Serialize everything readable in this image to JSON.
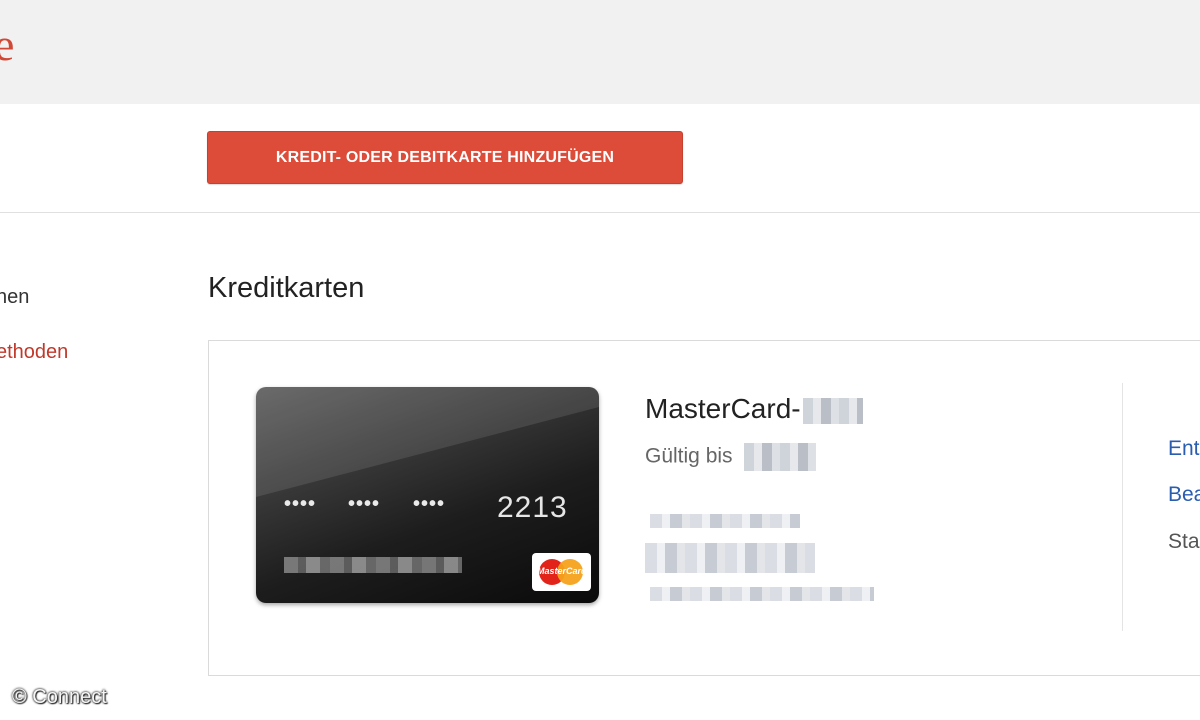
{
  "header": {
    "logo_fragment": "e"
  },
  "toolbar": {
    "add_card_label": "KREDIT- ODER DEBITKARTE HINZUFÜGEN"
  },
  "sidebar": {
    "items": [
      {
        "label": "hen",
        "active": false
      },
      {
        "label": "ethoden",
        "active": true
      }
    ]
  },
  "main": {
    "section_title": "Kreditkarten",
    "card": {
      "masked_groups": [
        "••••",
        "••••",
        "••••"
      ],
      "last4": "2213",
      "brand_label": "MasterCard",
      "name": "MasterCard-",
      "valid_label": "Gültig bis",
      "actions": {
        "remove": "Ent",
        "edit": "Bea",
        "status": "Sta"
      }
    }
  },
  "watermark": "© Connect",
  "colors": {
    "accent": "#dd4b39",
    "link": "#2a5db0",
    "active_nav": "#c0392b"
  }
}
